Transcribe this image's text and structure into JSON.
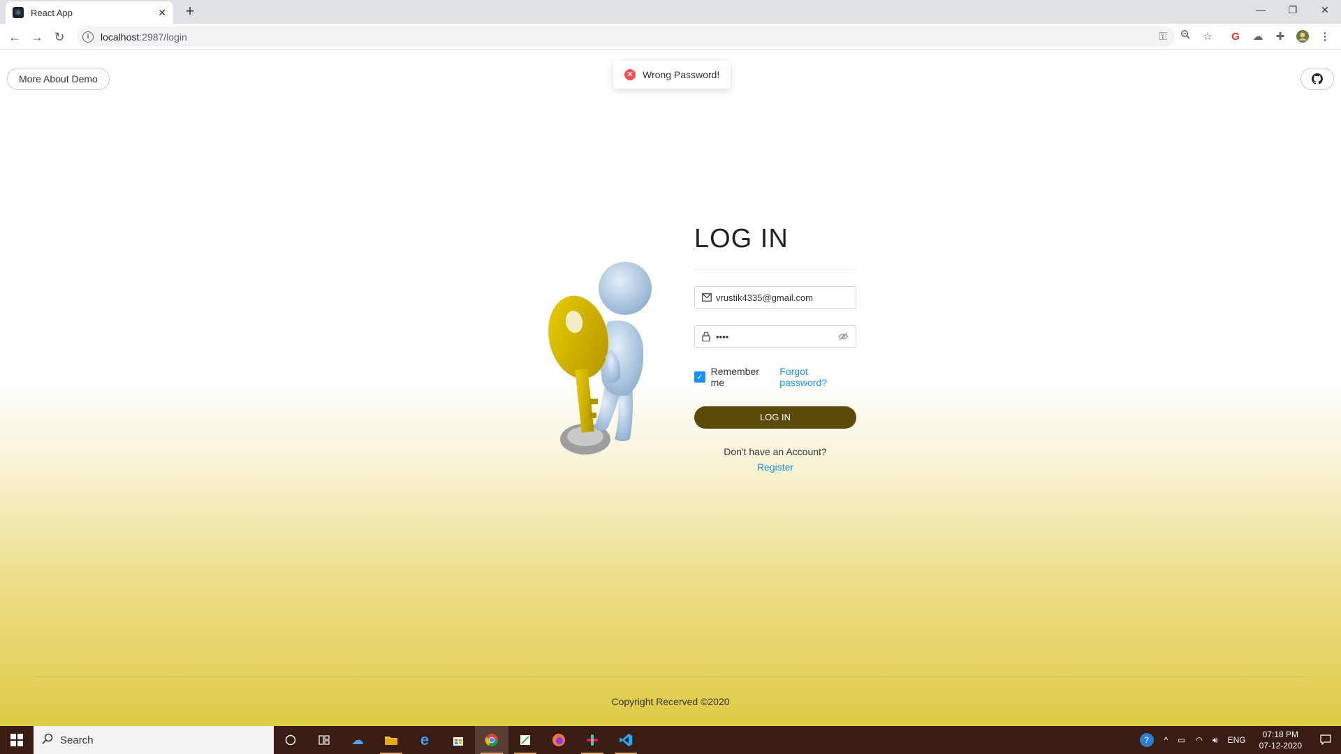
{
  "browser": {
    "tab_title": "React App",
    "url_host": "localhost",
    "url_path": ":2987/login"
  },
  "page": {
    "about_button": "More About Demo",
    "toast_message": "Wrong Password!",
    "heading": "LOG IN",
    "email_value": "vrustik4335@gmail.com",
    "password_masked": "••••",
    "remember_label": "Remember me",
    "remember_checked": true,
    "forgot_link": "Forgot password?",
    "login_button": "LOG IN",
    "no_account_text": "Don't have an Account?",
    "register_link": "Register",
    "copyright": "Copyright Recerved ©2020"
  },
  "taskbar": {
    "search_placeholder": "Search",
    "language": "ENG",
    "time": "07:18 PM",
    "date": "07-12-2020"
  },
  "colors": {
    "primary_link": "#1890ff",
    "login_button_bg": "#5a4a08",
    "gradient_bottom": "#dfca44",
    "error": "#ff4d4f"
  }
}
